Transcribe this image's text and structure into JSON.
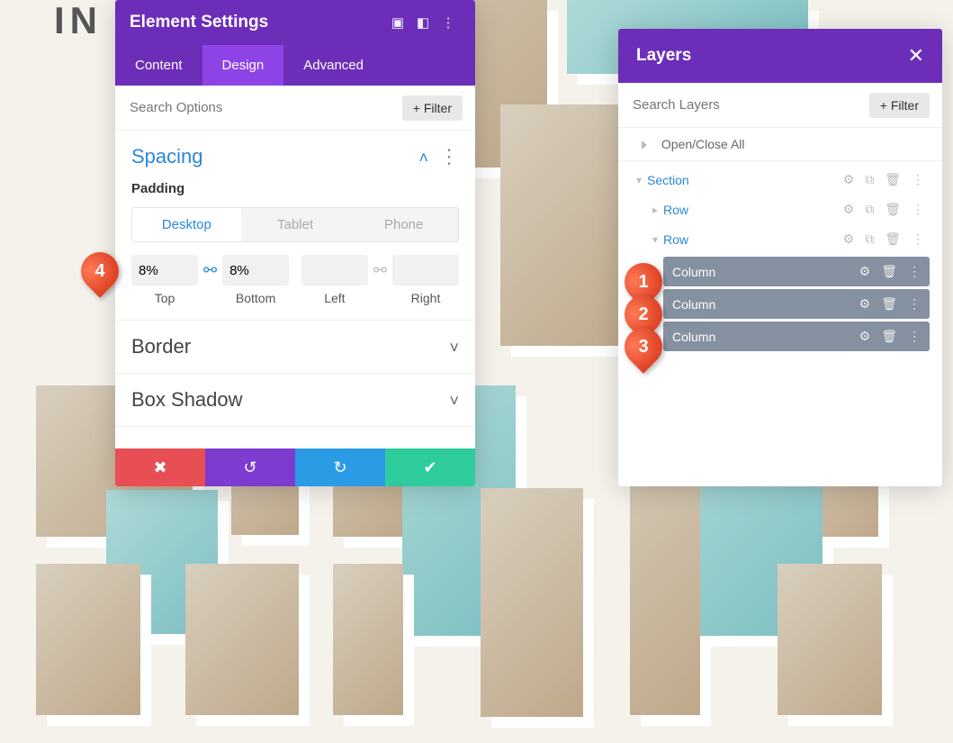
{
  "bgText": "IN\nBU",
  "settings": {
    "title": "Element Settings",
    "tabs": {
      "content": "Content",
      "design": "Design",
      "advanced": "Advanced"
    },
    "searchPlaceholder": "Search Options",
    "filter": "Filter",
    "spacing": {
      "title": "Spacing",
      "paddingLabel": "Padding",
      "devices": {
        "desktop": "Desktop",
        "tablet": "Tablet",
        "phone": "Phone"
      },
      "pad": {
        "top": {
          "val": "8%",
          "lbl": "Top"
        },
        "bot": {
          "val": "8%",
          "lbl": "Bottom"
        },
        "left": {
          "val": "",
          "lbl": "Left"
        },
        "right": {
          "val": "",
          "lbl": "Right"
        }
      }
    },
    "border": "Border",
    "boxShadow": "Box Shadow"
  },
  "layers": {
    "title": "Layers",
    "searchPlaceholder": "Search Layers",
    "filter": "Filter",
    "openClose": "Open/Close All",
    "items": {
      "section": "Section",
      "row1": "Row",
      "row2": "Row",
      "col1": "Column",
      "col2": "Column",
      "col3": "Column"
    }
  },
  "callouts": {
    "c1": "1",
    "c2": "2",
    "c3": "3",
    "c4": "4"
  }
}
